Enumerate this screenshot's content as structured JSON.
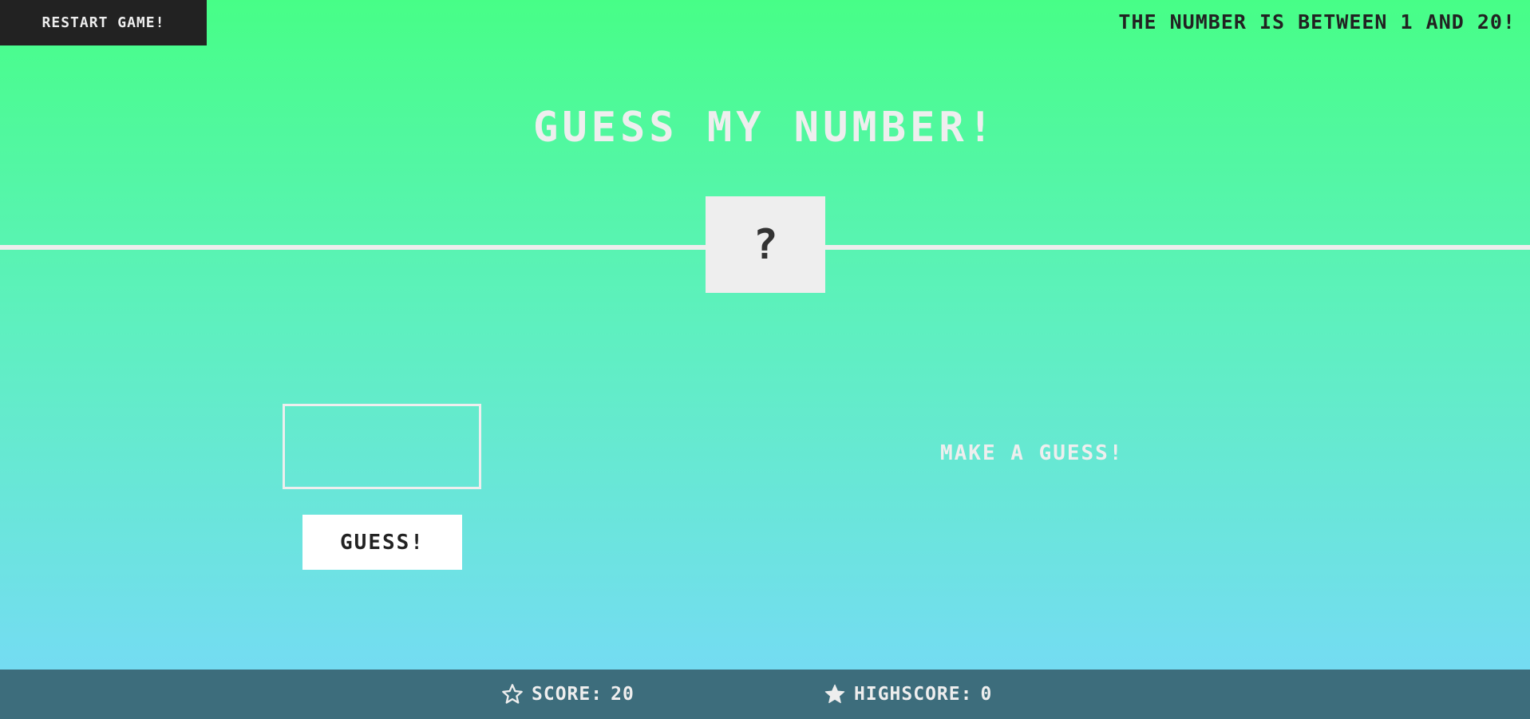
{
  "header": {
    "restart_label": "Restart Game!",
    "hint": "The number is between 1 and 20!"
  },
  "title": "Guess My Number!",
  "secret_number_display": "?",
  "guess": {
    "input_value": "",
    "button_label": "Guess!"
  },
  "message": "Make a guess!",
  "footer": {
    "score_label": "Score:",
    "score_value": "20",
    "highscore_label": "Highscore:",
    "highscore_value": "0",
    "score_icon": "star-outline-icon",
    "highscore_icon": "star-filled-icon"
  },
  "colors": {
    "gradient_top": "#47fe87",
    "gradient_bottom": "#74dcf2",
    "footer_bg": "#3d6d7c",
    "restart_bg": "#222222",
    "light_text": "#eeeeee"
  }
}
